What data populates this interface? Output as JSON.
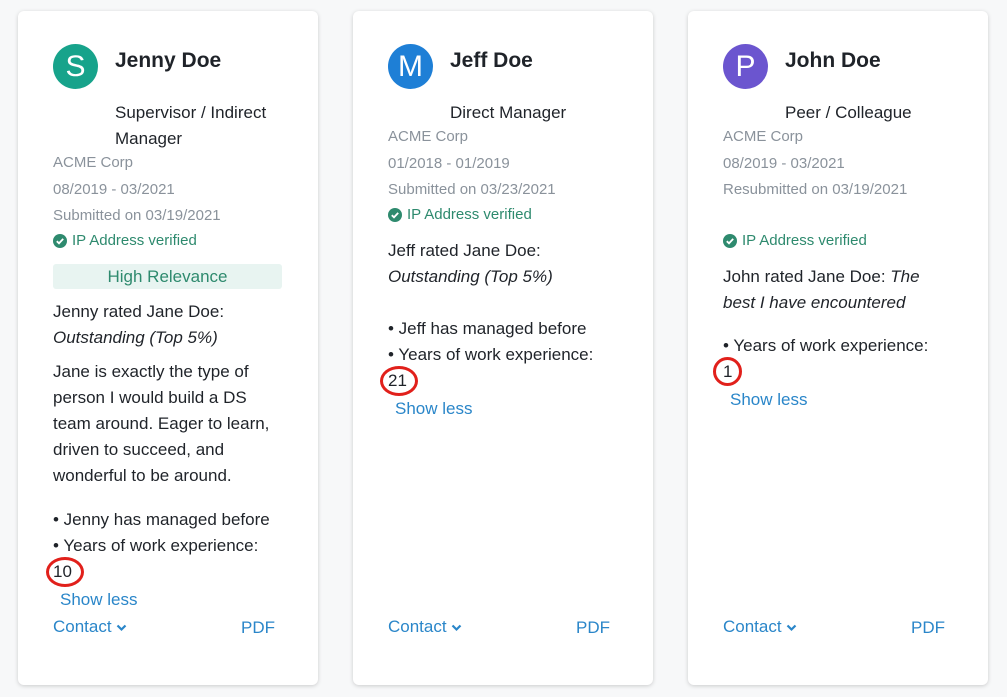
{
  "cards": [
    {
      "initial": "S",
      "avatar_color": "#17a38b",
      "name": "Jenny Doe",
      "role": "Supervisor / Indirect Manager",
      "company": "ACME Corp",
      "dates": "08/2019 - 03/2021",
      "submitted": "Submitted on 03/19/2021",
      "verified": "IP Address verified",
      "relevance": "High Relevance",
      "rating_prefix": "Jenny rated Jane Doe:",
      "rating": "Outstanding (Top 5%)",
      "comment": "Jane is exactly the type of person I would build a DS team around. Eager to learn, driven to succeed, and wonderful to be around.",
      "bullet1": "• Jenny has managed before",
      "bullet2": "• Years of work experience:",
      "years": "10",
      "show_less": "Show less",
      "contact": "Contact",
      "pdf": "PDF"
    },
    {
      "initial": "M",
      "avatar_color": "#1e7fd6",
      "name": "Jeff Doe",
      "role": "Direct Manager",
      "company": "ACME Corp",
      "dates": "01/2018 - 01/2019",
      "submitted": "Submitted on 03/23/2021",
      "verified": "IP Address verified",
      "rating_prefix": "Jeff rated Jane Doe:",
      "rating": "Outstanding (Top 5%)",
      "bullet1": "• Jeff has managed before",
      "bullet2": "• Years of work experience:",
      "years": "21",
      "show_less": "Show less",
      "contact": "Contact",
      "pdf": "PDF"
    },
    {
      "initial": "P",
      "avatar_color": "#6b55cf",
      "name": "John Doe",
      "role": "Peer / Colleague",
      "company": "ACME Corp",
      "dates": "08/2019 - 03/2021",
      "submitted": "Resubmitted on 03/19/2021",
      "verified": "IP Address verified",
      "rating_prefix": "John rated Jane Doe:",
      "rating": "The best I have encountered",
      "bullet2": "• Years of work experience:",
      "years": "1",
      "show_less": "Show less",
      "contact": "Contact",
      "pdf": "PDF"
    }
  ]
}
